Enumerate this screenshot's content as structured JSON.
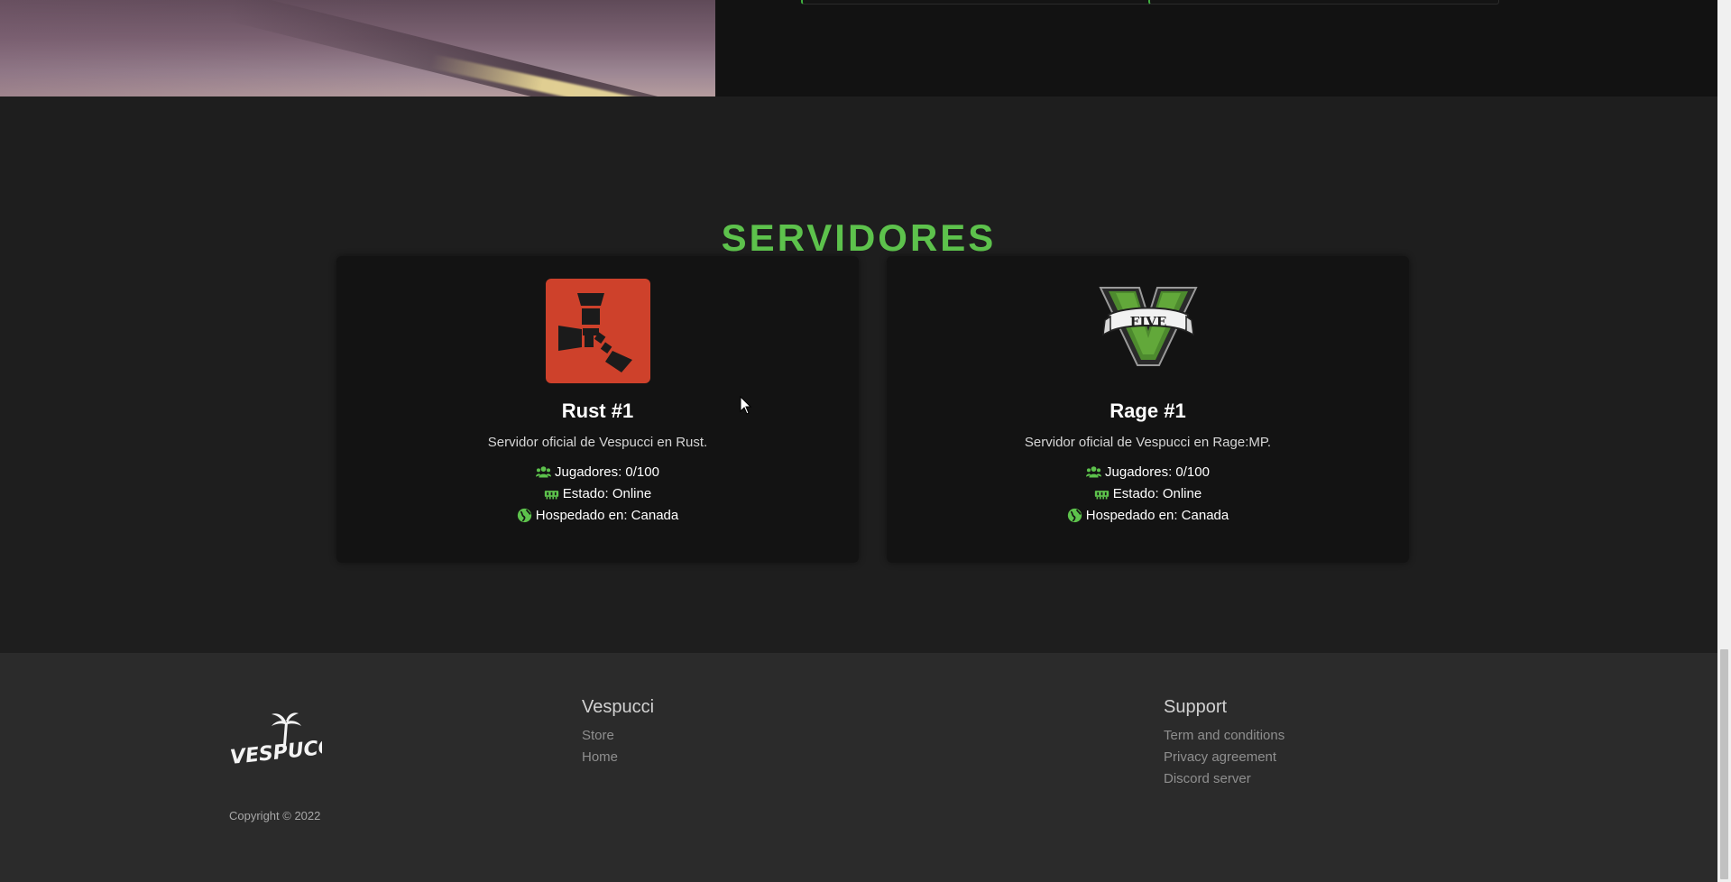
{
  "section": {
    "title": "SERVIDORES"
  },
  "servers": [
    {
      "name": "Rust #1",
      "description": "Servidor oficial de Vespucci en Rust.",
      "players": "Jugadores: 0/100",
      "status": "Estado: Online",
      "hosted": "Hospedado en: Canada",
      "logo_icon": "rust-logo-icon",
      "logo_color": "#ce412b"
    },
    {
      "name": "Rage #1",
      "description": "Servidor oficial de Vespucci en Rage:MP.",
      "players": "Jugadores: 0/100",
      "status": "Estado: Online",
      "hosted": "Hospedado en: Canada",
      "logo_icon": "gta-five-logo-icon",
      "logo_text": "FIVE"
    }
  ],
  "footer": {
    "brand_logo_text": "VESPUCCI",
    "copyright": "Copyright © 2022",
    "columns": [
      {
        "title": "Vespucci",
        "links": [
          "Store",
          "Home"
        ]
      },
      {
        "title": "Support",
        "links": [
          "Term and conditions",
          "Privacy agreement",
          "Discord server"
        ]
      }
    ]
  },
  "colors": {
    "accent": "#5dc24c",
    "page_bg": "#1e1e1e",
    "card_bg": "#131313",
    "footer_bg": "#2b2b2b"
  }
}
